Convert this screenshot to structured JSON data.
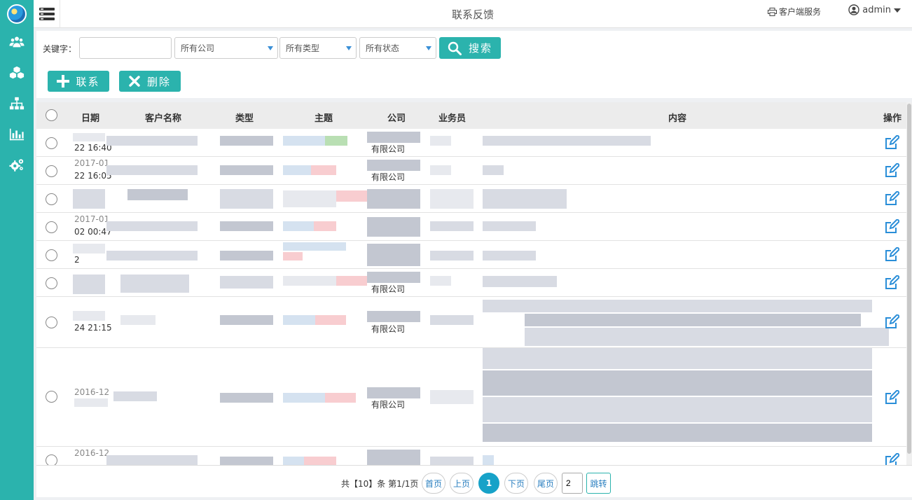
{
  "page_title": "联系反馈",
  "header": {
    "client_service_label": "客户端服务",
    "username": "admin"
  },
  "filters": {
    "keyword_label": "关键字：",
    "keyword_value": "",
    "company_select": "所有公司",
    "type_select": "所有类型",
    "status_select": "所有状态",
    "search_label": "搜索"
  },
  "actions": {
    "contact_label": "联系",
    "delete_label": "删除"
  },
  "table": {
    "columns": [
      "日期",
      "客户名称",
      "类型",
      "主题",
      "公司",
      "业务员",
      "内容",
      "操作"
    ],
    "rows": [
      {
        "date_line2": "22 16:40",
        "company_suffix": "有限公司"
      },
      {
        "date_line1": "2017-01",
        "date_line2": "22 16:05",
        "company_suffix": "有限公司"
      },
      {},
      {
        "date_line1": "2017-01",
        "date_line2": "02 00:47"
      },
      {
        "date_line2": "2"
      },
      {
        "company_suffix": "有限公司"
      },
      {
        "date_line2": "24 21:15",
        "company_suffix": "有限公司"
      },
      {
        "date_line1": "2016-12",
        "company_suffix": "有限公司"
      },
      {
        "date_line1": "2016-12"
      }
    ]
  },
  "pagination": {
    "summary": "共【10】条 第1/1页",
    "first": "首页",
    "prev": "上页",
    "current": "1",
    "next": "下页",
    "last": "尾页",
    "jump_value": "2",
    "jump_label": "跳转"
  },
  "colors": {
    "accent": "#2bb3ad",
    "page_active": "#17a2c8",
    "select_arrow": "#3a8fd6"
  }
}
